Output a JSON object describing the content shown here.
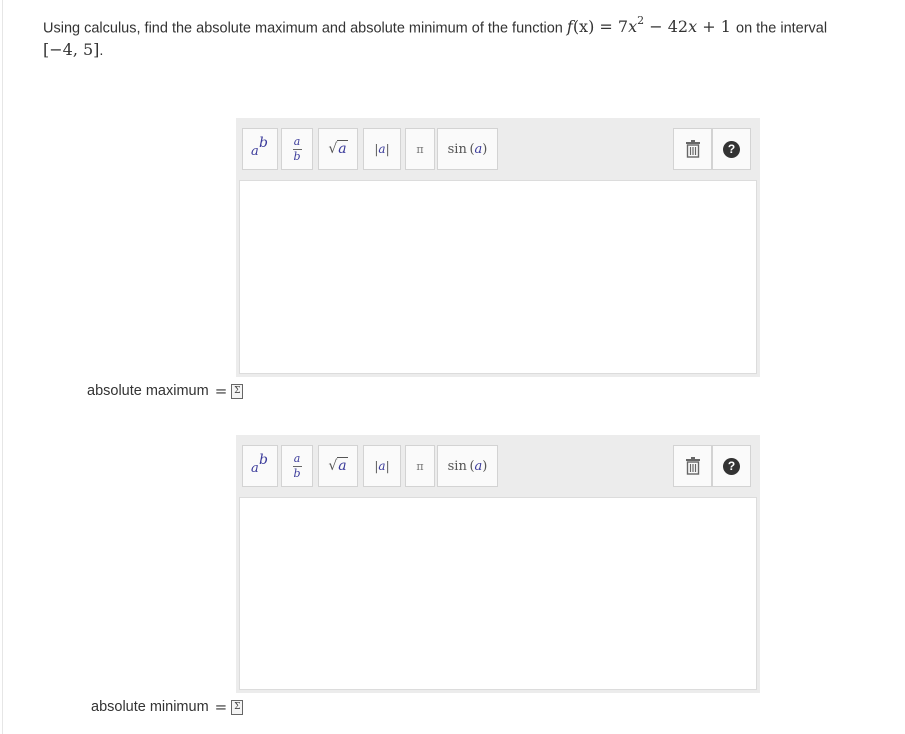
{
  "question": {
    "intro": "Using calculus, find the absolute maximum and absolute minimum of the function",
    "function_name": "f",
    "function_arg": "(x)",
    "equals": "=",
    "term1_coef": "7",
    "term1_var": "x",
    "term1_exp": "2",
    "minus": "−",
    "term2": "42",
    "term2_var": "x",
    "plus": "+",
    "constant": "1",
    "connector": "on the interval",
    "interval": "[−4, 5]",
    "trailing": "."
  },
  "toolbar": {
    "sup_base": "a",
    "sup_exp": "b",
    "frac_num": "a",
    "frac_den": "b",
    "sqrt_symbol": "√",
    "sqrt_arg": "a",
    "abs_label": "|a|",
    "abs_inner": "a",
    "pi_label": "π",
    "sin_label": "sin",
    "sin_open": "(",
    "sin_arg": "a",
    "sin_close": ")",
    "help_label": "?"
  },
  "answers": {
    "max_label": "absolute maximum",
    "min_label": "absolute minimum",
    "equals": "=",
    "max_value": "",
    "min_value": ""
  },
  "icons": [
    "superscript-icon",
    "fraction-icon",
    "sqrt-icon",
    "abs-icon",
    "pi-icon",
    "sin-icon",
    "trash-icon",
    "help-icon",
    "equation-icon"
  ]
}
